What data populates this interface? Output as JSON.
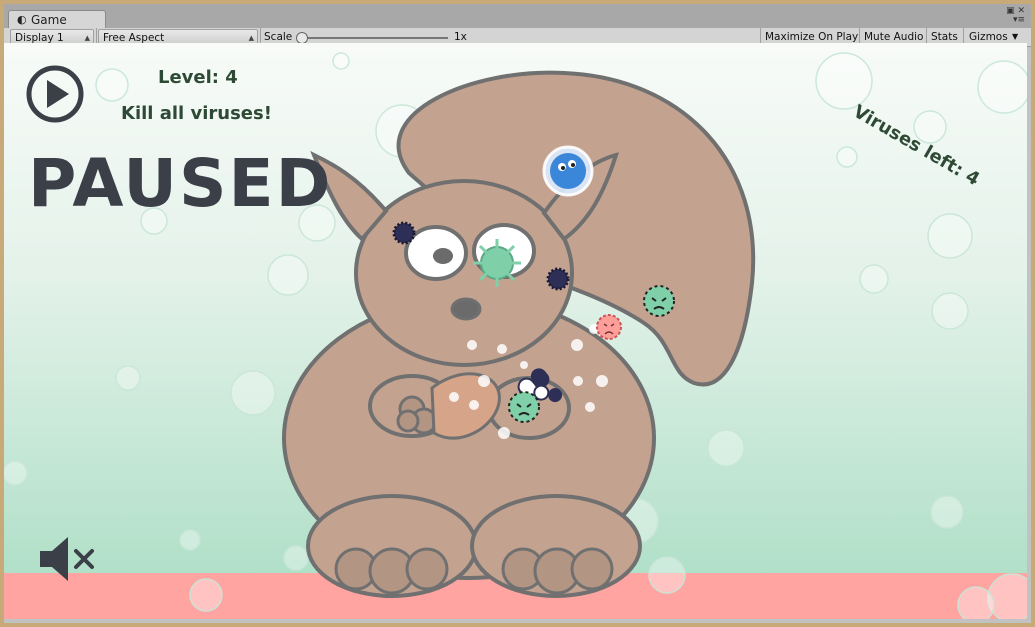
{
  "window": {
    "tab_label": "Game",
    "tab_icon": "unity-icon"
  },
  "toolbar": {
    "display": "Display 1",
    "aspect": "Free Aspect",
    "scale_label": "Scale",
    "scale_value": "1x",
    "maximize_on_play": "Maximize On Play",
    "mute_audio": "Mute Audio",
    "stats": "Stats",
    "gizmos": "Gizmos"
  },
  "hud": {
    "level": "Level: 4",
    "mission": "Kill all viruses!",
    "paused": "PAUSED",
    "viruses_left": "Viruses left: 4",
    "play_icon": "play-icon",
    "mute_icon": "speaker-muted-icon"
  },
  "colors": {
    "floor": "#ffa4a0",
    "squirrel": "#c3a390",
    "outline": "#6e6e6e",
    "hud_text": "#2e4a35",
    "paused_text": "#3a3f48",
    "virus_green": "#7fd0a8",
    "virus_red": "#ff9f9a",
    "virus_dark": "#2e2f57"
  }
}
